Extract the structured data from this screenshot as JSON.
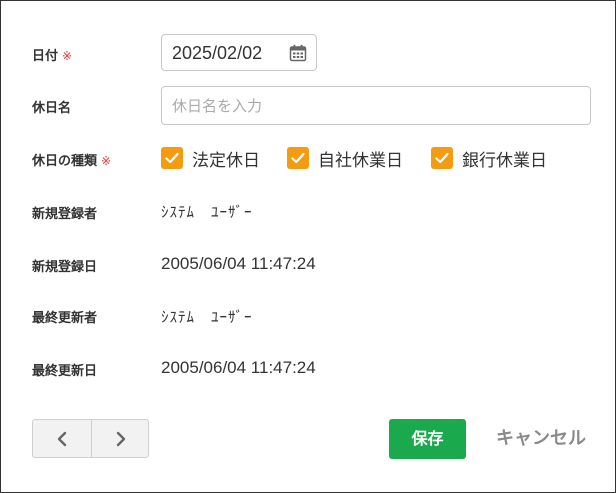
{
  "form": {
    "date": {
      "label": "日付",
      "required_mark": "※",
      "value": "2025/02/02"
    },
    "holiday_name": {
      "label": "休日名",
      "placeholder": "休日名を入力",
      "value": ""
    },
    "holiday_type": {
      "label": "休日の種類",
      "required_mark": "※",
      "options": [
        {
          "label": "法定休日",
          "checked": true
        },
        {
          "label": "自社休業日",
          "checked": true
        },
        {
          "label": "銀行休業日",
          "checked": true
        }
      ]
    },
    "created_by": {
      "label": "新規登録者",
      "value": "ｼｽﾃﾑ　ﾕｰｻﾞｰ"
    },
    "created_at": {
      "label": "新規登録日",
      "value": "2005/06/04 11:47:24"
    },
    "updated_by": {
      "label": "最終更新者",
      "value": "ｼｽﾃﾑ　ﾕｰｻﾞｰ"
    },
    "updated_at": {
      "label": "最終更新日",
      "value": "2005/06/04 11:47:24"
    }
  },
  "actions": {
    "save_label": "保存",
    "cancel_label": "キャンセル"
  },
  "pager": {
    "prev_icon": "chevron-left-icon",
    "next_icon": "chevron-right-icon"
  },
  "colors": {
    "accent_checkbox": "#f39c12",
    "save_button": "#1aaa4d",
    "required_mark": "#e53935",
    "cancel_text": "#8a8a8a"
  }
}
